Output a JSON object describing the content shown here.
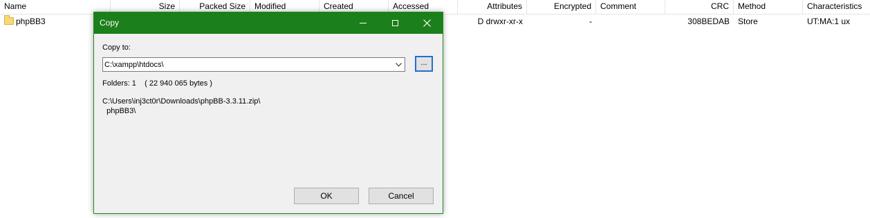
{
  "listview": {
    "columns": [
      {
        "label": "Name"
      },
      {
        "label": "Size"
      },
      {
        "label": "Packed Size"
      },
      {
        "label": "Modified"
      },
      {
        "label": "Created"
      },
      {
        "label": "Accessed"
      },
      {
        "label": "Attributes"
      },
      {
        "label": "Encrypted"
      },
      {
        "label": "Comment"
      },
      {
        "label": "CRC"
      },
      {
        "label": "Method"
      },
      {
        "label": "Characteristics"
      }
    ],
    "rows": [
      {
        "icon": "folder-icon",
        "name": "phpBB3",
        "attributes": "D drwxr-xr-x",
        "encrypted": "-",
        "crc": "308BEDAB",
        "method": "Store",
        "characteristics": "UT:MA:1 ux"
      }
    ]
  },
  "dialog": {
    "title": "Copy",
    "copy_to_label": "Copy to:",
    "destination_value": "C:\\xampp\\htdocs\\",
    "browse_label": "...",
    "folders_info": "Folders: 1    ( 22 940 065 bytes )",
    "source_path": "C:\\Users\\inj3ct0r\\Downloads\\phpBB-3.3.11.zip\\",
    "source_item": "  phpBB3\\",
    "ok_label": "OK",
    "cancel_label": "Cancel",
    "titlebar_color": "#1b7f1b",
    "titlebar_icons": [
      "minimize-icon",
      "maximize-icon",
      "close-icon"
    ]
  }
}
